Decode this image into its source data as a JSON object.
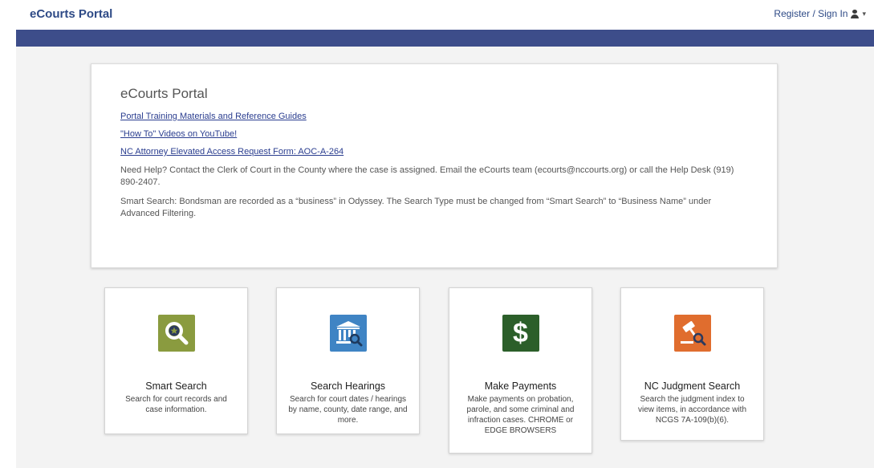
{
  "header": {
    "brand": "eCourts Portal",
    "signin": "Register / Sign In"
  },
  "info": {
    "title": "eCourts Portal",
    "links": [
      "Portal Training Materials and Reference Guides",
      "\"How To\" Videos on YouTube!",
      "NC Attorney Elevated Access Request Form: AOC-A-264"
    ],
    "help_text": "Need Help? Contact the Clerk of Court in the County where the case is assigned. Email the eCourts team (ecourts@nccourts.org) or call the Help Desk (919) 890-2407.",
    "smart_search_text": "Smart Search: Bondsman are recorded as a “business” in Odyssey. The Search Type must be changed from “Smart Search” to “Business Name” under Advanced Filtering."
  },
  "tiles": [
    {
      "title": "Smart Search",
      "desc": "Search for court records and case information.",
      "icon": "magnifier-star-icon",
      "color": "#8a9b3f"
    },
    {
      "title": "Search Hearings",
      "desc": "Search for court dates / hearings by name, county, date range, and more.",
      "icon": "courthouse-search-icon",
      "color": "#3f84c4"
    },
    {
      "title": "Make Payments",
      "desc": "Make payments on probation, parole, and some criminal and infraction cases. CHROME or EDGE BROWSERS",
      "icon": "dollar-icon",
      "color": "#2c5f2a"
    },
    {
      "title": "NC Judgment Search",
      "desc": "Search the judgment index to view items, in accordance with NCGS 7A-109(b)(6).",
      "icon": "gavel-search-icon",
      "color": "#e06d2e"
    }
  ]
}
